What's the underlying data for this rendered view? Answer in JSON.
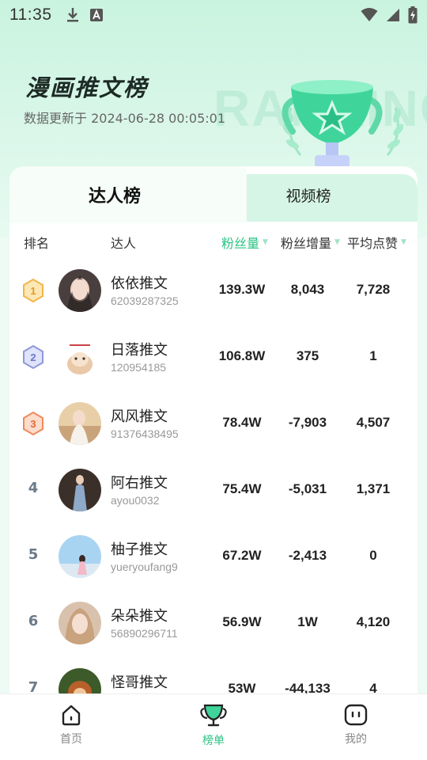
{
  "status": {
    "time": "11:35"
  },
  "hero": {
    "title": "漫画推文榜",
    "update_text": "数据更新于 2024-06-28 00:05:01",
    "watermark": "RANKING"
  },
  "tabs": [
    {
      "label": "达人榜",
      "active": true
    },
    {
      "label": "视频榜",
      "active": false
    }
  ],
  "table": {
    "headers": {
      "rank": "排名",
      "user": "达人",
      "fans": "粉丝量",
      "growth": "粉丝增量",
      "likes": "平均点赞"
    },
    "rows": [
      {
        "rank": "1",
        "name": "依依推文",
        "uid": "62039287325",
        "fans": "139.3W",
        "growth": "8,043",
        "likes": "7,728"
      },
      {
        "rank": "2",
        "name": "日落推文",
        "uid": "120954185",
        "fans": "106.8W",
        "growth": "375",
        "likes": "1"
      },
      {
        "rank": "3",
        "name": "风风推文",
        "uid": "91376438495",
        "fans": "78.4W",
        "growth": "-7,903",
        "likes": "4,507"
      },
      {
        "rank": "4",
        "name": "阿右推文",
        "uid": "ayou0032",
        "fans": "75.4W",
        "growth": "-5,031",
        "likes": "1,371"
      },
      {
        "rank": "5",
        "name": "柚子推文",
        "uid": "yueryoufang9",
        "fans": "67.2W",
        "growth": "-2,413",
        "likes": "0"
      },
      {
        "rank": "6",
        "name": "朵朵推文",
        "uid": "56890296711",
        "fans": "56.9W",
        "growth": "1W",
        "likes": "4,120"
      },
      {
        "rank": "7",
        "name": "怪哥推文",
        "uid": "",
        "fans": "53W",
        "growth": "-44,133",
        "likes": "4"
      }
    ]
  },
  "bottom_nav": [
    {
      "label": "首页",
      "icon": "home-icon",
      "active": false
    },
    {
      "label": "榜单",
      "icon": "trophy-icon",
      "active": true
    },
    {
      "label": "我的",
      "icon": "profile-icon",
      "active": false
    }
  ],
  "colors": {
    "accent": "#2bc383",
    "gold": "#f2b64a",
    "silver": "#8f98d9",
    "bronze": "#f08a5d"
  }
}
